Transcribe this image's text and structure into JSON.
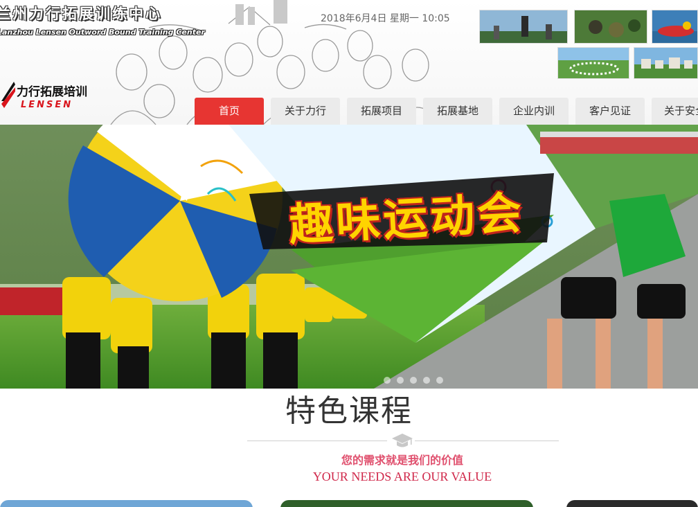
{
  "header": {
    "brand_cn": "兰州力行拓展训练中心",
    "brand_en": "Lanzhou Lensen Outword Bound Training Center",
    "logo_cn": "力行拓展培训",
    "logo_en": "LENSEN",
    "datetime": "2018年6月4日 星期一 10:05"
  },
  "nav": {
    "items": [
      {
        "label": "首页",
        "active": true
      },
      {
        "label": "关于力行"
      },
      {
        "label": "拓展项目"
      },
      {
        "label": "拓展基地"
      },
      {
        "label": "企业内训"
      },
      {
        "label": "客户见证"
      },
      {
        "label": "关于安全"
      }
    ]
  },
  "banner": {
    "headline": "趣味运动会",
    "slides_count": 5
  },
  "feature": {
    "title": "特色课程",
    "tagline_cn": "您的需求就是我们的价值",
    "tagline_en": "YOUR NEEDS ARE OUR VALUE"
  },
  "colors": {
    "accent": "#e73532",
    "nav_bg": "#ebebeb",
    "tagline_cn": "#e0506e",
    "tagline_en": "#d0284a"
  }
}
